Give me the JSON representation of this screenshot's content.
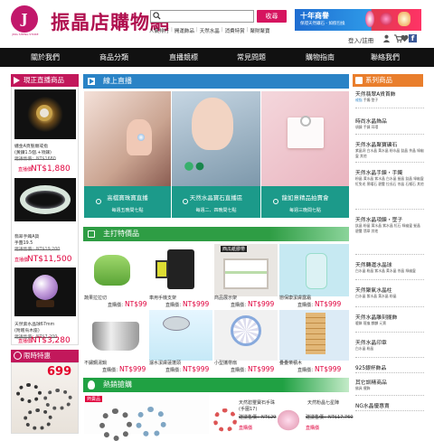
{
  "header": {
    "logo_text": "J",
    "logo_sub": "JING SHENG STORE",
    "site_title": "振晶店購物網",
    "search_placeholder": "",
    "search_button": "收尋",
    "hot_links": [
      "人氣排行",
      "開運飾品",
      "天然水晶",
      "消費特賞",
      "聚財聚寶"
    ],
    "promo_line1": "十年商譽",
    "promo_line2": "保證天然礦石 - 如假包換",
    "account_link": "登入/註冊",
    "account_icons": [
      "user-icon",
      "cart-icon",
      "heart-icon",
      "facebook-icon"
    ]
  },
  "nav": {
    "items": [
      "關於我們",
      "商品分類",
      "直播競標",
      "常見問題",
      "購物指南",
      "聯絡我們"
    ]
  },
  "left_live": {
    "title": "現正直播商品",
    "items": [
      {
        "name": "纏金A頁聖願戒指",
        "desc": "(黃鑽1.5個.+項鍊)",
        "orig": "建議售價：NT$1680",
        "price_label": "直播價",
        "price": "NT$1,880"
      },
      {
        "name": "翡翠手鐲A貨",
        "desc": "手圍19.5",
        "orig": "建議售價：NT$19,200",
        "price_label": "直播價",
        "price": "NT$11,500"
      },
      {
        "name": "天然紫水晶球67mm",
        "desc": "(附贈烏木座)",
        "orig": "建議售價：NT$7,200",
        "price_label": "直播價",
        "price": "NT$3,280"
      }
    ]
  },
  "left_limited": {
    "title": "限時特惠",
    "badge": "699"
  },
  "live_section": {
    "title": "線上直播",
    "banners": [
      {
        "title": "高檔寶珠寶直播",
        "time": "每週五晚間七點"
      },
      {
        "title": "天然水晶寶石直播區",
        "time": "每週二、四晚間七點"
      },
      {
        "title": "龍如意精品拍賣會",
        "time": "每週三晚間七點"
      }
    ]
  },
  "featured": {
    "title": "主打特價品",
    "row1": [
      {
        "name": "蔬果拉拉切",
        "price_label": "直購價：",
        "price": "NT$99"
      },
      {
        "name": "車用手機支架",
        "price_label": "直購價：",
        "price": "NT$999"
      },
      {
        "name": "商品展示架",
        "price_label": "直購價：",
        "price": "NT$999"
      },
      {
        "name": "戀保康潔膚露霜",
        "price_label": "直購價：",
        "price": "NT$999"
      }
    ],
    "row2": [
      {
        "name": "不鏽鋼湯鍋",
        "price_label": "直購價：",
        "price": "NT$999"
      },
      {
        "name": "濾水潔膚蓮蓬頭",
        "price_label": "直購價：",
        "price": "NT$999"
      },
      {
        "name": "小型攜帶扇",
        "price_label": "直購價：",
        "price": "NT$999"
      },
      {
        "name": "疊疊樂積木",
        "price_label": "直購價：",
        "price": "NT$999"
      }
    ],
    "sticker": "西瓜紙膠帶"
  },
  "hot_sale": {
    "title": "熱銷搶購",
    "tag": "熱賣品",
    "items": [
      {
        "name": "天然碧璽寶石手珠",
        "desc": "(手圍17)",
        "orig": "建議售價：NT$29,700",
        "price_label": "直購價",
        "price": ""
      },
      {
        "name": "天然粉晶七星陣",
        "desc": "",
        "orig": "建議售價：NT$17,760",
        "price_label": "直購價",
        "price": ""
      }
    ]
  },
  "right_cat": {
    "title": "系列商品",
    "categories": [
      {
        "name": "天然翡翠A貨首飾",
        "subs": [
          "戒指",
          "手鐲",
          "墜子"
        ],
        "active": "戒指"
      },
      {
        "name": "時尚水晶飾品",
        "subs": [
          "項鍊",
          "手鍊",
          "耳環"
        ]
      },
      {
        "name": "天然水晶聚寶礦石",
        "subs": [
          "紫晶洞",
          "白水晶",
          "黃水晶",
          "粉水晶",
          "鈦晶",
          "茶晶",
          "綠幽靈",
          "其他"
        ]
      },
      {
        "name": "天然水晶手鍊・手鐲",
        "subs": [
          "粉晶",
          "黃水晶",
          "紫水晶",
          "白水晶",
          "髮晶",
          "鈦晶",
          "綠幽靈",
          "紅兔毛",
          "黑曜石",
          "碧璽",
          "拉長石",
          "茶晶",
          "石榴石",
          "其他"
        ]
      },
      {
        "name": "天然水晶項鍊・墜子",
        "subs": [
          "鈦晶",
          "粉晶",
          "黃水晶",
          "紫水晶",
          "紅石",
          "綠幽靈",
          "髮晶",
          "碧璽",
          "翡翠",
          "其他"
        ]
      },
      {
        "name": "天然轉運水晶球",
        "subs": [
          "白水晶",
          "粉晶",
          "紫水晶",
          "黃水晶",
          "茶晶",
          "綠幽靈"
        ]
      },
      {
        "name": "天然聚氣水晶柱",
        "subs": [
          "白水晶",
          "紫水晶",
          "黃水晶",
          "粉晶"
        ]
      },
      {
        "name": "天然水晶雕刻擺飾",
        "subs": [
          "貔貅",
          "龍龜",
          "麒麟",
          "元寶"
        ]
      },
      {
        "name": "天然水晶印章",
        "subs": [
          "白水晶",
          "粉晶"
        ]
      },
      {
        "name": "925銀杯飾品",
        "subs": []
      },
      {
        "name": "其它訓精商品",
        "subs": [
          "佛具",
          "擺飾"
        ]
      },
      {
        "name": "NG水晶優惠賣",
        "subs": []
      }
    ]
  },
  "colors": {
    "brand": "#c2185b",
    "nav": "#111111",
    "price": "#e0003c",
    "live_blue": "#2a83c6",
    "featured_green": "#2e9d44",
    "hot_green": "#20a143",
    "teal_overlay": "#1c9a8a"
  }
}
